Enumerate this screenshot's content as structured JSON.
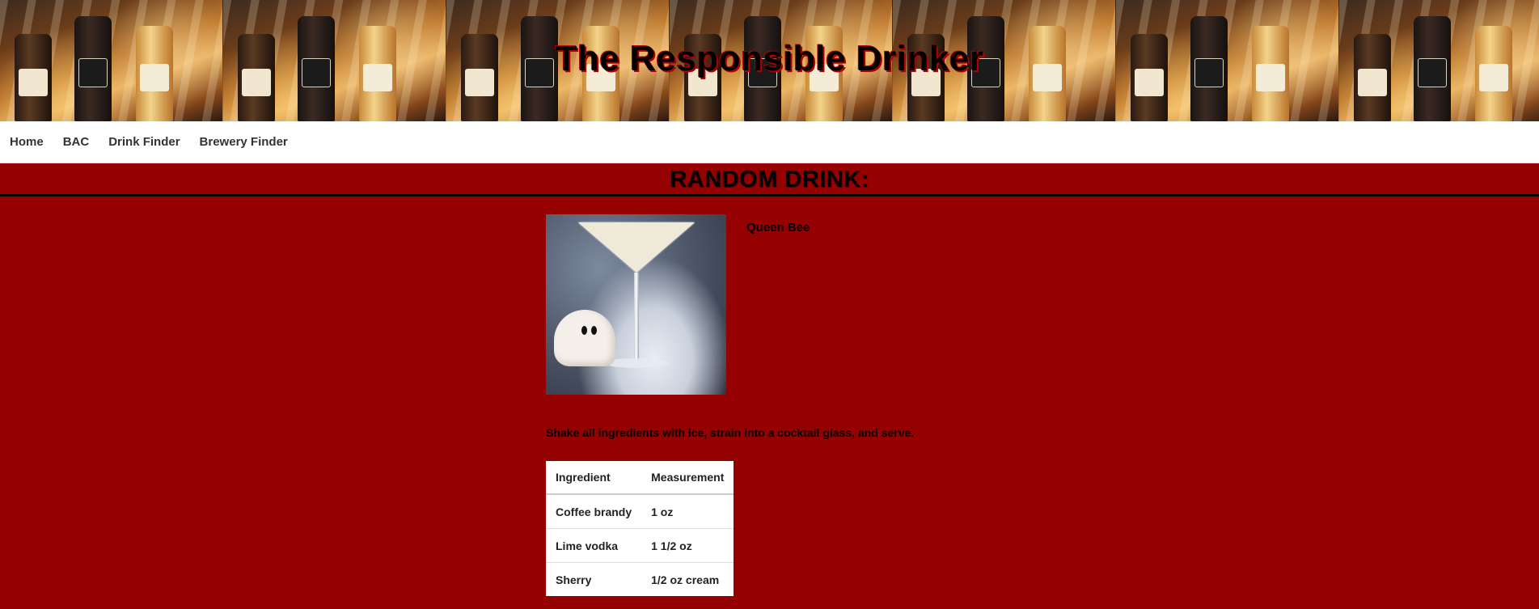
{
  "site": {
    "title": "The Responsible Drinker"
  },
  "nav": {
    "items": [
      {
        "label": "Home"
      },
      {
        "label": "BAC"
      },
      {
        "label": "Drink Finder"
      },
      {
        "label": "Brewery Finder"
      }
    ]
  },
  "section": {
    "heading": "RANDOM DRINK:"
  },
  "drink": {
    "name": "Queen Bee",
    "instructions": "Shake all ingredients with ice, strain into a cocktail glass, and serve.",
    "table": {
      "headers": [
        "Ingredient",
        "Measurement"
      ],
      "rows": [
        [
          "Coffee brandy",
          "1 oz"
        ],
        [
          "Lime vodka",
          "1 1/2 oz"
        ],
        [
          "Sherry",
          "1/2 oz cream"
        ]
      ]
    }
  },
  "colors": {
    "page_background": "#950000",
    "nav_background": "#ffffff",
    "title_shadow": "#b00000"
  },
  "icons": {
    "banner": "whiskey-bottles-image",
    "drink_photo": "martini-glass-image"
  }
}
